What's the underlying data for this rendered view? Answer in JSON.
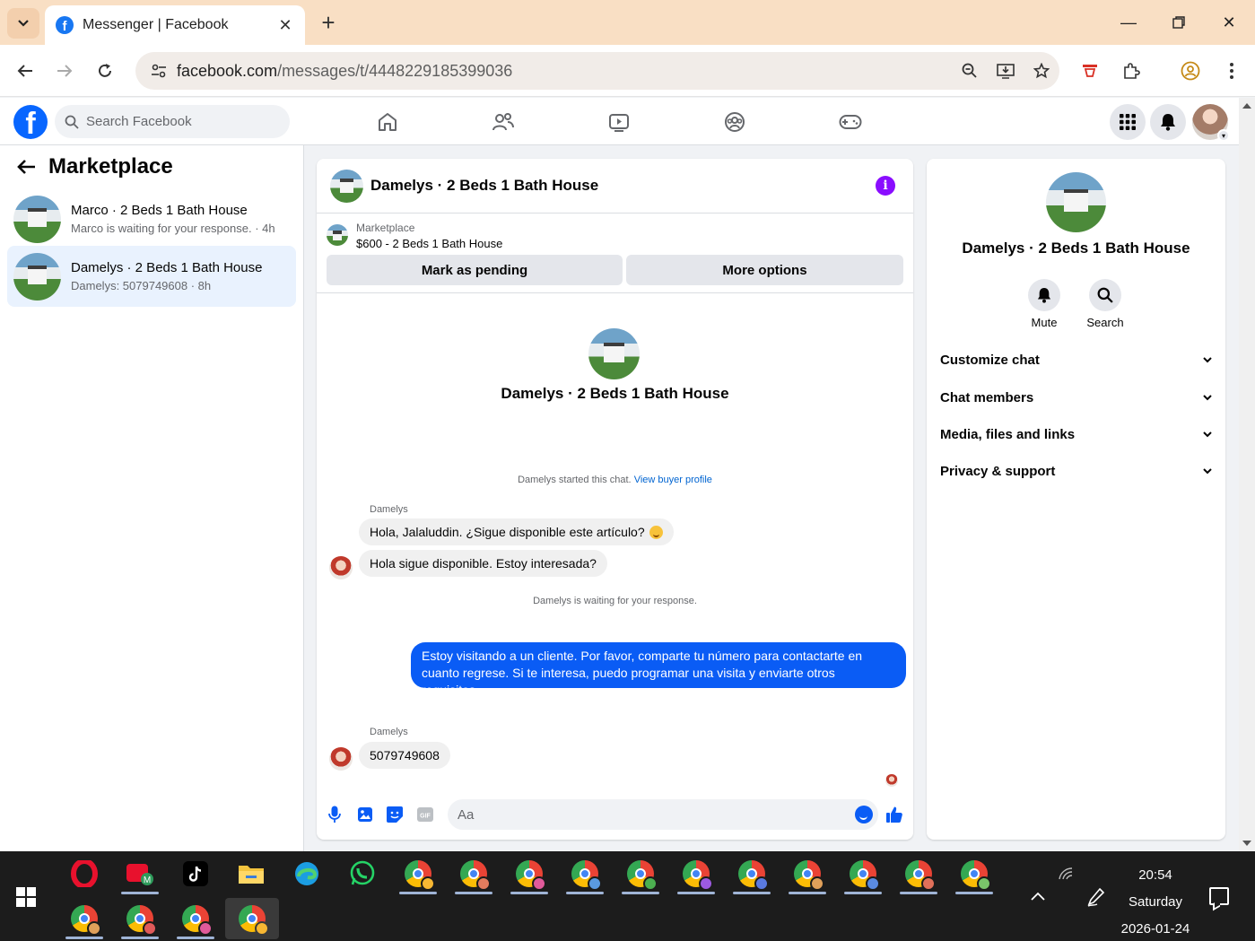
{
  "browser": {
    "tab_title": "Messenger | Facebook",
    "url_host": "facebook.com",
    "url_path": "/messages/t/4448229185399036"
  },
  "fb_header": {
    "search_placeholder": "Search Facebook",
    "nav_icons": [
      "home-icon",
      "friends-icon",
      "video-icon",
      "groups-icon",
      "gaming-icon"
    ],
    "right_icons": [
      "menu-grid-icon",
      "notifications-icon",
      "profile-avatar"
    ]
  },
  "sidebar": {
    "title": "Marketplace",
    "threads": [
      {
        "name": "Marco · 2 Beds 1 Bath House",
        "preview": "Marco is waiting for your response. · 4h",
        "active": false
      },
      {
        "name": "Damelys · 2 Beds 1 Bath House",
        "preview": "Damelys: 5079749608 · 8h",
        "active": true
      }
    ]
  },
  "conversation": {
    "header_name": "Damelys · 2 Beds 1 Bath House",
    "listing": {
      "label": "Marketplace",
      "price_title": "$600 - 2 Beds 1 Bath House",
      "btn_pending": "Mark as pending",
      "btn_more": "More options"
    },
    "intro_name": "Damelys · 2 Beds 1 Bath House",
    "started_text": "Damelys started this chat.",
    "view_buyer_link": "View buyer profile",
    "messages": [
      {
        "sender": "Damelys",
        "text": "Hola, Jalaluddin. ¿Sigue disponible este artículo?"
      },
      {
        "text": "Hola sigue disponible. Estoy interesada?"
      }
    ],
    "waiting_text": "Damelys is waiting for your response.",
    "outgoing_message": "Estoy visitando a un cliente. Por favor, comparte tu número para contactarte en cuanto regrese. Si te interesa, puedo programar una visita y enviarte otros requisitos.",
    "last_sender": "Damelys",
    "last_message": "5079749608",
    "composer_placeholder": "Aa",
    "composer_icons": [
      "microphone-icon",
      "photo-icon",
      "sticker-icon",
      "gif-icon",
      "emoji-icon",
      "thumbs-up-icon"
    ]
  },
  "details": {
    "name": "Damelys · 2 Beds 1 Bath House",
    "actions": {
      "mute": "Mute",
      "search": "Search"
    },
    "sections": [
      "Customize chat",
      "Chat members",
      "Media, files and links",
      "Privacy & support"
    ]
  },
  "taskbar": {
    "time": "20:54",
    "day": "Saturday",
    "date": "2026-01-24"
  },
  "colors": {
    "fb_blue": "#0866ff",
    "messenger_blue": "#0a5cf5",
    "info_purple": "#8a0dff",
    "active_thread_bg": "#e9f2fe",
    "tabbar_bg": "#f9dfc4"
  }
}
